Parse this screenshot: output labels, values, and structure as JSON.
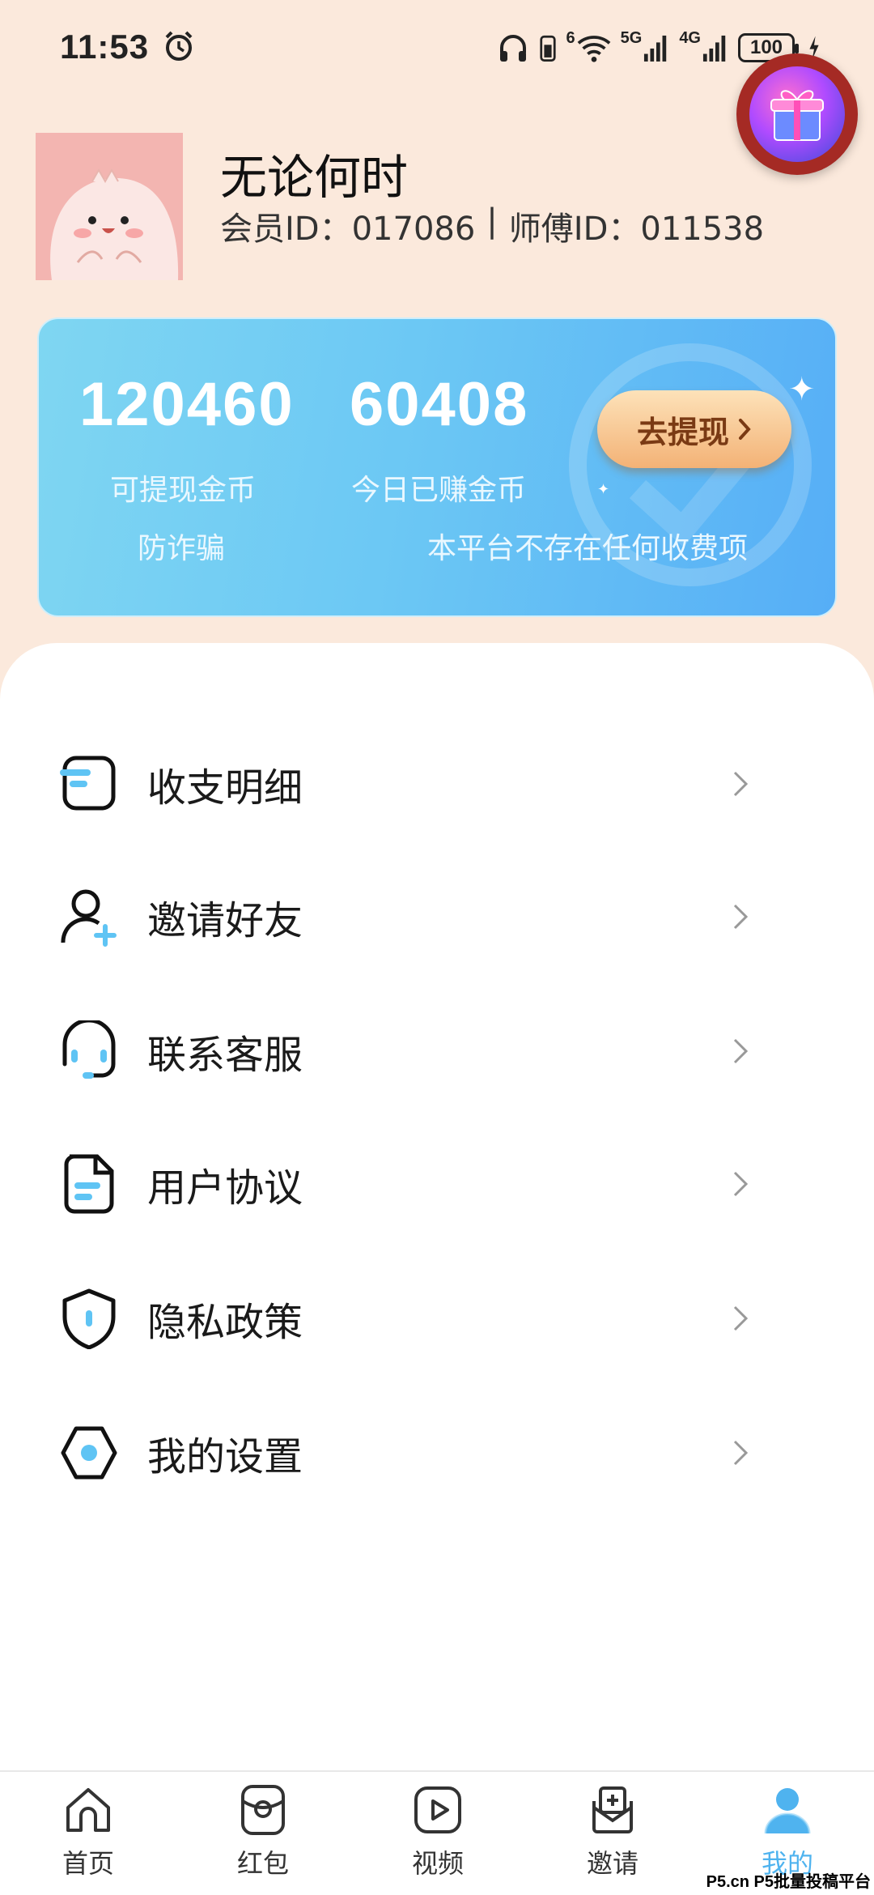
{
  "status_bar": {
    "time": "11:53",
    "net_5g": "5G",
    "net_4g": "4G",
    "wifi_sub": "6",
    "battery": "100"
  },
  "profile": {
    "username": "无论何时",
    "member_id": "会员ID：017086",
    "master_id": "师傅ID：011538",
    "separator": "|"
  },
  "wallet": {
    "withdrawable_coins": "120460",
    "withdrawable_label": "可提现金币",
    "today_coins": "60408",
    "today_label": "今日已赚金币",
    "withdraw_button": "去提现",
    "notice_title": "防诈骗",
    "notice_text": "本平台不存在任何收费项"
  },
  "menu": [
    {
      "label": "收支明细",
      "icon": "ledger-icon"
    },
    {
      "label": "邀请好友",
      "icon": "add-user-icon"
    },
    {
      "label": "联系客服",
      "icon": "headset-icon"
    },
    {
      "label": "用户协议",
      "icon": "document-icon"
    },
    {
      "label": "隐私政策",
      "icon": "shield-icon"
    },
    {
      "label": "我的设置",
      "icon": "settings-icon"
    }
  ],
  "nav": [
    {
      "label": "首页",
      "icon": "home-icon"
    },
    {
      "label": "红包",
      "icon": "red-envelope-icon"
    },
    {
      "label": "视频",
      "icon": "video-icon"
    },
    {
      "label": "邀请",
      "icon": "invite-icon"
    },
    {
      "label": "我的",
      "icon": "profile-icon",
      "active": true
    }
  ],
  "watermark": "P5.cn P5批量投稿平台",
  "colors": {
    "page_bg": "#fbe9dc",
    "card_gradient_start": "#7fd6f2",
    "card_gradient_end": "#56aef6",
    "accent_blue": "#4fb3ef",
    "withdraw_text": "#7a3a14"
  }
}
